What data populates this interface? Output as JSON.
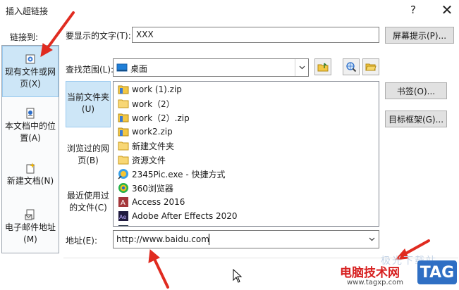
{
  "window": {
    "title": "插入超链接",
    "help_symbol": "?",
    "close_symbol": "✕"
  },
  "sidebar": {
    "heading": "链接到:",
    "items": [
      {
        "label": "现有文件或网页(X)",
        "icon": "existing-file-icon",
        "selected": true
      },
      {
        "label": "本文档中的位置(A)",
        "icon": "place-in-document-icon",
        "selected": false
      },
      {
        "label": "新建文档(N)",
        "icon": "new-document-icon",
        "selected": false
      },
      {
        "label": "电子邮件地址(M)",
        "icon": "email-address-icon",
        "selected": false
      }
    ]
  },
  "display_text": {
    "label": "要显示的文字(T):",
    "value": "XXX"
  },
  "buttons": {
    "screentip": "屏幕提示(P)...",
    "bookmark": "书签(O)...",
    "target_frame": "目标框架(G)..."
  },
  "look_in": {
    "label": "查找范围(L):",
    "value": "桌面",
    "icon": "desktop-icon"
  },
  "places": [
    {
      "label": "当前文件夹(U)",
      "selected": true
    },
    {
      "label": "浏览过的网页(B)",
      "selected": false
    },
    {
      "label": "最近使用过的文件(C)",
      "selected": false
    }
  ],
  "files": [
    {
      "name": "work (1).zip",
      "icon": "zip-folder-icon"
    },
    {
      "name": "work（2）",
      "icon": "folder-icon"
    },
    {
      "name": "work（2）.zip",
      "icon": "zip-folder-icon"
    },
    {
      "name": "work2.zip",
      "icon": "zip-folder-icon"
    },
    {
      "name": "新建文件夹",
      "icon": "folder-icon"
    },
    {
      "name": "资源文件",
      "icon": "folder-icon"
    },
    {
      "name": "2345Pic.exe - 快捷方式",
      "icon": "2345pic-icon"
    },
    {
      "name": "360浏览器",
      "icon": "360-browser-icon"
    },
    {
      "name": "Access 2016",
      "icon": "access-icon"
    },
    {
      "name": "Adobe After Effects 2020",
      "icon": "after-effects-icon"
    }
  ],
  "address": {
    "label": "地址(E):",
    "value": "http://www.baidu.com"
  },
  "watermark": {
    "site_name": "电脑技术网",
    "url": "www.tagxp.com",
    "tag": "TAG"
  },
  "colors": {
    "selection": "#cde6f7",
    "annotation_arrow": "#e02b20",
    "watermark_red": "#d71f1f",
    "watermark_blue": "#2f6fc4"
  }
}
